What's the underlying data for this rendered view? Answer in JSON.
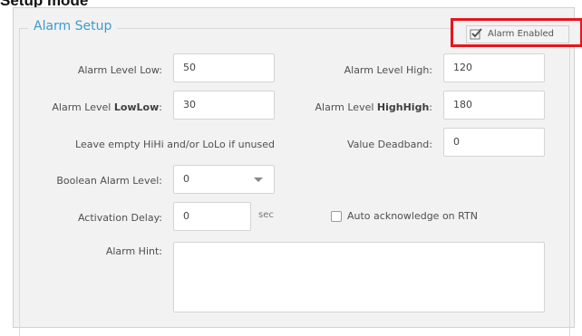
{
  "caption": "Setup mode",
  "section": {
    "title": "Alarm Setup",
    "enabled": {
      "label": "Alarm Enabled",
      "checked": true
    }
  },
  "fields": {
    "low": {
      "label": "Alarm Level Low:",
      "value": "50"
    },
    "high": {
      "label": "Alarm Level High:",
      "value": "120"
    },
    "lowlow": {
      "label_prefix": "Alarm Level ",
      "label_bold": "LowLow",
      "label_suffix": ":",
      "value": "30"
    },
    "highhigh": {
      "label_prefix": "Alarm Level ",
      "label_bold": "HighHigh",
      "label_suffix": ":",
      "value": "180"
    },
    "hint_note": "Leave empty HiHi and/or LoLo if unused",
    "deadband": {
      "label": "Value Deadband:",
      "value": "0"
    },
    "boolean_level": {
      "label": "Boolean Alarm Level:",
      "value": "0"
    },
    "activation_delay": {
      "label": "Activation Delay:",
      "value": "0",
      "unit": "sec"
    },
    "auto_ack": {
      "label": "Auto acknowledge on RTN",
      "checked": false
    },
    "alarm_hint": {
      "label": "Alarm Hint:",
      "value": ""
    }
  }
}
